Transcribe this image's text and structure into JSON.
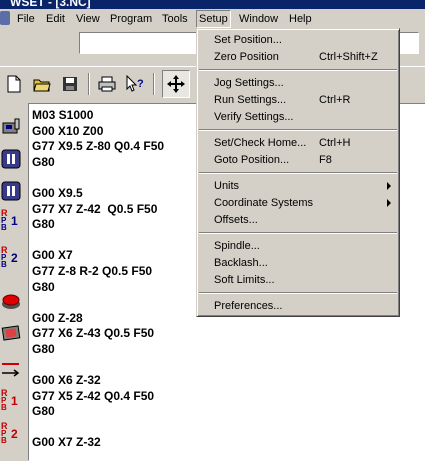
{
  "window": {
    "title": "WSET - [3.NC]"
  },
  "menubar": {
    "items": [
      {
        "label": "File"
      },
      {
        "label": "Edit"
      },
      {
        "label": "View"
      },
      {
        "label": "Program"
      },
      {
        "label": "Tools"
      },
      {
        "label": "Setup"
      },
      {
        "label": "Window"
      },
      {
        "label": "Help"
      }
    ]
  },
  "setup_menu": {
    "groups": [
      [
        {
          "label": "Set Position...",
          "shortcut": ""
        },
        {
          "label": "Zero Position",
          "shortcut": "Ctrl+Shift+Z"
        }
      ],
      [
        {
          "label": "Jog Settings...",
          "shortcut": ""
        },
        {
          "label": "Run Settings...",
          "shortcut": "Ctrl+R"
        },
        {
          "label": "Verify Settings...",
          "shortcut": ""
        }
      ],
      [
        {
          "label": "Set/Check Home...",
          "shortcut": "Ctrl+H"
        },
        {
          "label": "Goto Position...",
          "shortcut": "F8"
        }
      ],
      [
        {
          "label": "Units",
          "shortcut": "",
          "submenu": true
        },
        {
          "label": "Coordinate Systems",
          "shortcut": "",
          "submenu": true
        },
        {
          "label": "Offsets...",
          "shortcut": ""
        }
      ],
      [
        {
          "label": "Spindle...",
          "shortcut": ""
        },
        {
          "label": "Backlash...",
          "shortcut": ""
        },
        {
          "label": "Soft Limits...",
          "shortcut": ""
        }
      ],
      [
        {
          "label": "Preferences...",
          "shortcut": ""
        }
      ]
    ]
  },
  "toolbar": {
    "buttons": [
      {
        "icon": "new-file-icon"
      },
      {
        "icon": "open-folder-icon"
      },
      {
        "icon": "save-icon"
      },
      {
        "icon": "print-icon"
      },
      {
        "icon": "context-help-icon"
      },
      {
        "icon": "jog-move-icon"
      }
    ]
  },
  "left_toolbar": {
    "buttons": [
      {
        "icon": "tool-probe-icon",
        "label": ""
      },
      {
        "icon": "pause-icon",
        "label": ""
      },
      {
        "icon": "pause-alt-icon",
        "label": ""
      },
      {
        "icon": "rpb-icon",
        "label": "1"
      },
      {
        "icon": "rpb-icon",
        "label": "2"
      },
      {
        "icon": "emergency-stop-icon",
        "label": ""
      },
      {
        "icon": "reset-icon",
        "label": ""
      },
      {
        "icon": "arrow-right-icon",
        "label": ""
      },
      {
        "icon": "rpb-icon",
        "label": "1"
      },
      {
        "icon": "rpb-icon",
        "label": "2"
      }
    ]
  },
  "editor": {
    "content": "M03 S1000\nG00 X10 Z00\nG77 X9.5 Z-80 Q0.4 F50\nG80\n\nG00 X9.5\nG77 X7 Z-42  Q0.5 F50\nG80\n\nG00 X7\nG77 Z-8 R-2 Q0.5 F50\nG80\n\nG00 Z-28\nG77 X6 Z-43 Q0.5 F50\nG80\n\nG00 X6 Z-32\nG77 X5 Z-42 Q0.4 F50\nG80\n\nG00 X7 Z-32"
  }
}
